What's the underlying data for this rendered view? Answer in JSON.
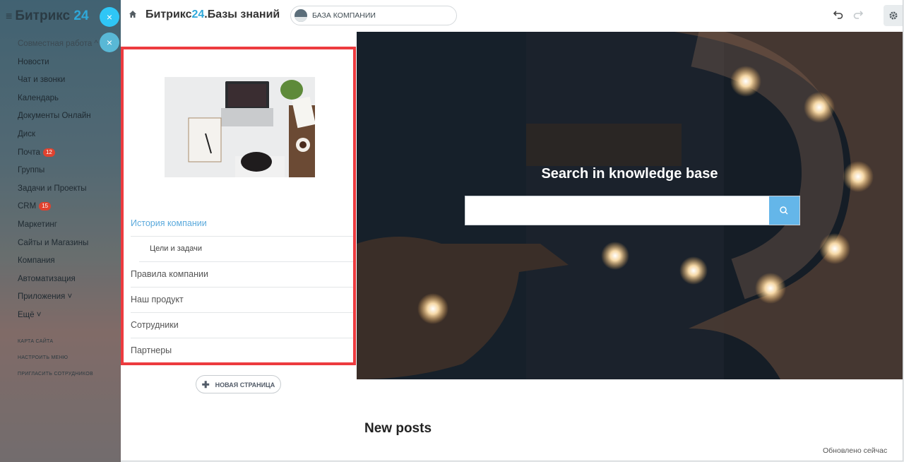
{
  "bitrix": {
    "logo_text": "Битрикс",
    "logo_num": "24",
    "nav": [
      {
        "label": "Совместная работа ^",
        "group": true
      },
      {
        "label": "Новости"
      },
      {
        "label": "Чат и звонки"
      },
      {
        "label": "Календарь"
      },
      {
        "label": "Документы Онлайн"
      },
      {
        "label": "Диск"
      },
      {
        "label": "Почта",
        "badge": "12"
      },
      {
        "label": "Группы"
      },
      {
        "label": "Задачи и Проекты"
      },
      {
        "label": "CRM",
        "badge": "15"
      },
      {
        "label": "Маркетинг"
      },
      {
        "label": "Сайты и Магазины"
      },
      {
        "label": "Компания"
      },
      {
        "label": "Автоматизация"
      },
      {
        "label": "Приложения ˅"
      },
      {
        "label": "Ещё ˅"
      }
    ],
    "footer_links": [
      "КАРТА САЙТА",
      "НАСТРОИТЬ МЕНЮ",
      "ПРИГЛАСИТЬ СОТРУДНИКОВ"
    ],
    "close_glyph": "×"
  },
  "header": {
    "title_prefix": "Битрикс",
    "title_num": "24",
    "title_suffix": ".Базы знаний",
    "kb_selector": "БАЗА КОМПАНИИ"
  },
  "menu": {
    "items": [
      {
        "label": "История компании",
        "active": true
      },
      {
        "label": "Цели и задачи",
        "sub": true
      },
      {
        "label": "Правила компании"
      },
      {
        "label": "Наш продукт"
      },
      {
        "label": "Сотрудники"
      },
      {
        "label": "Партнеры"
      }
    ],
    "new_page_label": "НОВАЯ СТРАНИЦА"
  },
  "hero": {
    "title": "Search in knowledge base",
    "search_placeholder": ""
  },
  "new_posts": "New posts",
  "updated": "Обновлено сейчас",
  "colors": {
    "accent": "#2fa8d9",
    "frame": "#ed3b3f",
    "search_button": "#64b6e9",
    "active_link": "#5aa9dc"
  }
}
